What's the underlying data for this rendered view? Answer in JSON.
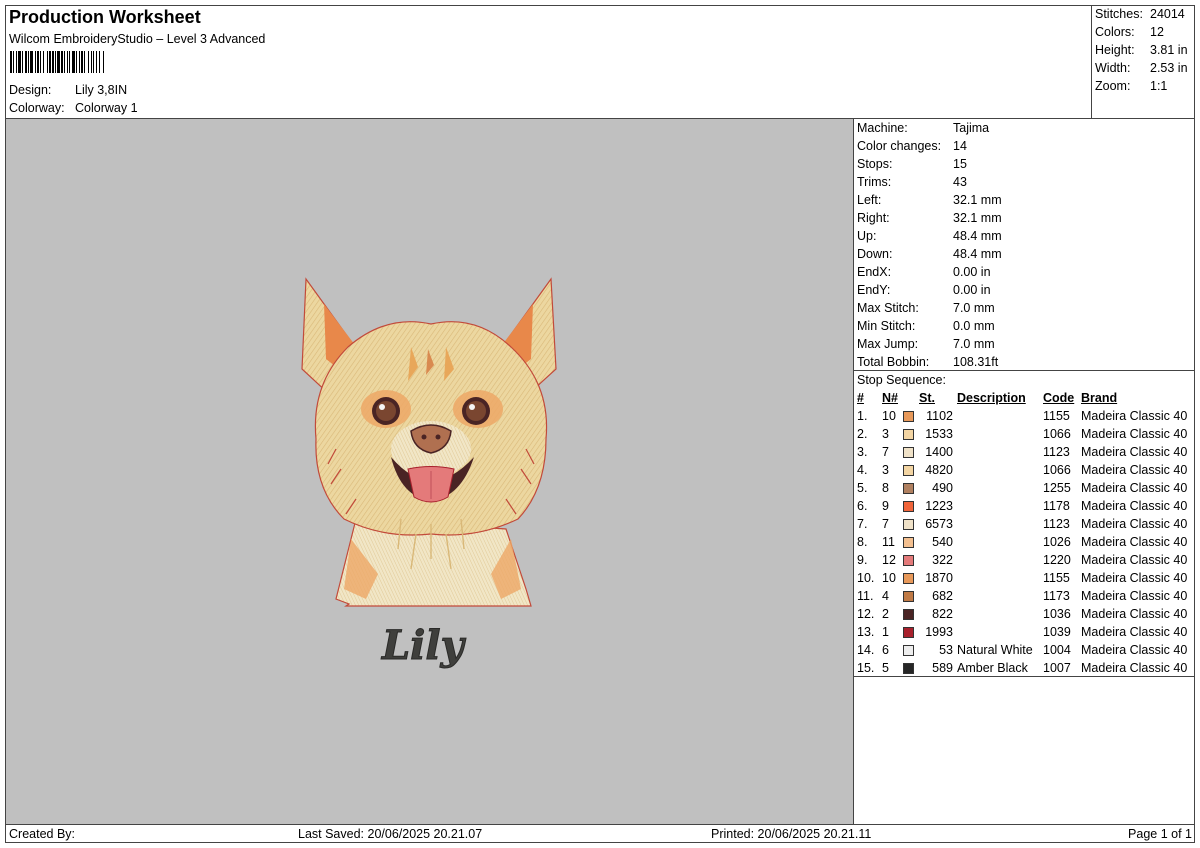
{
  "header": {
    "title": "Production Worksheet",
    "software": "Wilcom EmbroideryStudio – Level 3 Advanced",
    "design_label": "Design:",
    "design_value": "Lily 3,8IN",
    "colorway_label": "Colorway:",
    "colorway_value": "Colorway 1"
  },
  "summary": [
    {
      "label": "Stitches:",
      "value": "24014"
    },
    {
      "label": "Colors:",
      "value": "12"
    },
    {
      "label": "Height:",
      "value": "3.81 in"
    },
    {
      "label": "Width:",
      "value": "2.53 in"
    },
    {
      "label": "Zoom:",
      "value": "1:1"
    }
  ],
  "machine": [
    {
      "label": "Machine:",
      "value": "Tajima"
    },
    {
      "label": "Color changes:",
      "value": "14"
    },
    {
      "label": "Stops:",
      "value": "15"
    },
    {
      "label": "Trims:",
      "value": "43"
    },
    {
      "label": "Left:",
      "value": "32.1 mm"
    },
    {
      "label": "Right:",
      "value": "32.1 mm"
    },
    {
      "label": "Up:",
      "value": "48.4 mm"
    },
    {
      "label": "Down:",
      "value": "48.4 mm"
    },
    {
      "label": "EndX:",
      "value": "0.00 in"
    },
    {
      "label": "EndY:",
      "value": "0.00 in"
    },
    {
      "label": "Max Stitch:",
      "value": "7.0 mm"
    },
    {
      "label": "Min Stitch:",
      "value": "0.0 mm"
    },
    {
      "label": "Max Jump:",
      "value": "7.0 mm"
    },
    {
      "label": "Total Bobbin:",
      "value": "108.31ft"
    }
  ],
  "stop_sequence": {
    "caption": "Stop Sequence:",
    "headers": {
      "idx": "#",
      "n": "N#",
      "st": "St.",
      "desc": "Description",
      "code": "Code",
      "brand": "Brand"
    },
    "rows": [
      {
        "idx": "1.",
        "n": "10",
        "color": "#e8995a",
        "st": "1102",
        "desc": "",
        "code": "1155",
        "brand": "Madeira Classic 40"
      },
      {
        "idx": "2.",
        "n": "3",
        "color": "#f3d5a3",
        "st": "1533",
        "desc": "",
        "code": "1066",
        "brand": "Madeira Classic 40"
      },
      {
        "idx": "3.",
        "n": "7",
        "color": "#f0e2c8",
        "st": "1400",
        "desc": "",
        "code": "1123",
        "brand": "Madeira Classic 40"
      },
      {
        "idx": "4.",
        "n": "3",
        "color": "#f3d5a3",
        "st": "4820",
        "desc": "",
        "code": "1066",
        "brand": "Madeira Classic 40"
      },
      {
        "idx": "5.",
        "n": "8",
        "color": "#b08060",
        "st": "490",
        "desc": "",
        "code": "1255",
        "brand": "Madeira Classic 40"
      },
      {
        "idx": "6.",
        "n": "9",
        "color": "#f0643a",
        "st": "1223",
        "desc": "",
        "code": "1178",
        "brand": "Madeira Classic 40"
      },
      {
        "idx": "7.",
        "n": "7",
        "color": "#f0e2c8",
        "st": "6573",
        "desc": "",
        "code": "1123",
        "brand": "Madeira Classic 40"
      },
      {
        "idx": "8.",
        "n": "11",
        "color": "#f4c090",
        "st": "540",
        "desc": "",
        "code": "1026",
        "brand": "Madeira Classic 40"
      },
      {
        "idx": "9.",
        "n": "12",
        "color": "#e47a7a",
        "st": "322",
        "desc": "",
        "code": "1220",
        "brand": "Madeira Classic 40"
      },
      {
        "idx": "10.",
        "n": "10",
        "color": "#e8995a",
        "st": "1870",
        "desc": "",
        "code": "1155",
        "brand": "Madeira Classic 40"
      },
      {
        "idx": "11.",
        "n": "4",
        "color": "#c07a46",
        "st": "682",
        "desc": "",
        "code": "1173",
        "brand": "Madeira Classic 40"
      },
      {
        "idx": "12.",
        "n": "2",
        "color": "#4a2424",
        "st": "822",
        "desc": "",
        "code": "1036",
        "brand": "Madeira Classic 40"
      },
      {
        "idx": "13.",
        "n": "1",
        "color": "#a8202c",
        "st": "1993",
        "desc": "",
        "code": "1039",
        "brand": "Madeira Classic 40"
      },
      {
        "idx": "14.",
        "n": "6",
        "color": "#eeeeee",
        "st": "53",
        "desc": "Natural White",
        "code": "1004",
        "brand": "Madeira Classic 40"
      },
      {
        "idx": "15.",
        "n": "5",
        "color": "#262626",
        "st": "589",
        "desc": "Amber Black",
        "code": "1007",
        "brand": "Madeira Classic 40"
      }
    ]
  },
  "preview": {
    "background": "#c0c0c0",
    "name_text": "Lily"
  },
  "footer": {
    "created_by": "Created By:",
    "last_saved": "Last Saved: 20/06/2025 20.21.07",
    "printed": "Printed: 20/06/2025 20.21.11",
    "page": "Page 1 of 1"
  }
}
